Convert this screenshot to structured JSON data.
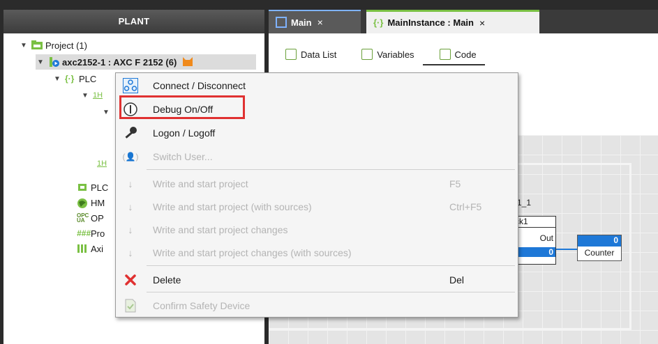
{
  "plant": {
    "header": "PLANT",
    "tree": {
      "project": "Project (1)",
      "controller": "axc2152-1 : AXC F 2152 (6)",
      "plc_prefix": "PLC",
      "plc_short": "PLC",
      "hmi_short": "HM",
      "opc_short": "OP",
      "profinet_short": "Pro",
      "axio_short": "Axi",
      "hl_short": "1H"
    }
  },
  "editor": {
    "tabs": [
      {
        "label": "Main",
        "close": "×"
      },
      {
        "label": "MainInstance : Main",
        "close": "×"
      }
    ],
    "subtabs": [
      "Data List",
      "Variables",
      "Code"
    ],
    "diagram": {
      "instance_label_partial": "x1_1",
      "fb_name_partial": "ck1",
      "fb_output": "Out",
      "fb_value": "0",
      "counter_value": "0",
      "counter_name": "Counter"
    }
  },
  "context_menu": {
    "items": [
      {
        "label": "Connect / Disconnect",
        "icon": "connect-icon",
        "enabled": true,
        "shortcut": ""
      },
      {
        "label": "Debug On/Off",
        "icon": "debug-icon",
        "enabled": true,
        "shortcut": "",
        "highlighted": true
      },
      {
        "label": "Logon / Logoff",
        "icon": "key-icon",
        "enabled": true,
        "shortcut": ""
      },
      {
        "label": "Switch User...",
        "icon": "switch-user-icon",
        "enabled": false,
        "shortcut": ""
      },
      {
        "label": "Write and start project",
        "icon": "write-start-icon",
        "enabled": false,
        "shortcut": "F5"
      },
      {
        "label": "Write and start project (with sources)",
        "icon": "write-start-sources-icon",
        "enabled": false,
        "shortcut": "Ctrl+F5"
      },
      {
        "label": "Write and start project changes",
        "icon": "write-changes-icon",
        "enabled": false,
        "shortcut": ""
      },
      {
        "label": "Write and start project changes (with sources)",
        "icon": "write-changes-sources-icon",
        "enabled": false,
        "shortcut": ""
      },
      {
        "label": "Delete",
        "icon": "delete-icon",
        "enabled": true,
        "shortcut": "Del"
      },
      {
        "label": "Confirm Safety Device",
        "icon": "confirm-safety-icon",
        "enabled": false,
        "shortcut": ""
      }
    ]
  },
  "colors": {
    "accent_blue": "#1e78d7",
    "highlight_red": "#e03131",
    "plc_green": "#7ac043",
    "badge_orange": "#f08a1c"
  }
}
